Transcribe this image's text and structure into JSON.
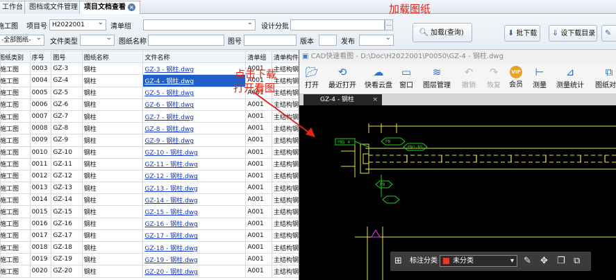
{
  "tabs": [
    {
      "label": "工作台"
    },
    {
      "label": "图档或文件管理"
    },
    {
      "label": "项目文档查看",
      "close": "×"
    }
  ],
  "annotations": {
    "load_drawing": "加载图纸",
    "click_download_line1": "点击下载",
    "click_download_line2": "打开看图"
  },
  "filters": {
    "drawing_label": "施工图",
    "project_no_label": "项目号",
    "project_no_value": "H2022001",
    "checklist_label": "清单组",
    "checklist_value": "",
    "design_batch_label": "设计分批",
    "design_batch_value": "",
    "category_value": "-全部图纸-",
    "file_type_label": "文件类型",
    "file_type_value": "",
    "drawing_name_label": "图纸名称",
    "drawing_name_value": "",
    "drawing_no_label": "图号",
    "drawing_no_value": "",
    "version_label": "版本",
    "version_value": "",
    "publish_label": "发布",
    "publish_value": "",
    "dots": "..."
  },
  "buttons": {
    "load": "加载(查询)",
    "batch_download": "批下载",
    "set_download_dir": "设下载目录"
  },
  "table": {
    "headers": [
      "图纸类别",
      "序号",
      "图号",
      "图纸名称",
      "文件名称",
      "清单组",
      "清单构件"
    ],
    "rows": [
      [
        "施工图",
        "0003",
        "GZ-3",
        "钢柱",
        "GZ-3 - 钢柱.dwg",
        "A001",
        "主结构钢"
      ],
      [
        "施工图",
        "0004",
        "GZ-4",
        "钢柱",
        "GZ-4 - 钢柱.dwg",
        "A001",
        "主结构钢"
      ],
      [
        "施工图",
        "0005",
        "GZ-5",
        "钢柱",
        "GZ-5 - 钢柱.dwg",
        "A001",
        "主结构钢"
      ],
      [
        "施工图",
        "0006",
        "GZ-6",
        "钢柱",
        "GZ-6 - 钢柱.dwg",
        "A001",
        "主结构钢"
      ],
      [
        "施工图",
        "0007",
        "GZ-7",
        "钢柱",
        "GZ-7 - 钢柱.dwg",
        "A001",
        "主结构钢"
      ],
      [
        "施工图",
        "0008",
        "GZ-8",
        "钢柱",
        "GZ-8 - 钢柱.dwg",
        "A001",
        "主结构钢"
      ],
      [
        "施工图",
        "0009",
        "GZ-9",
        "钢柱",
        "GZ-9 - 钢柱.dwg",
        "A001",
        "主结构钢"
      ],
      [
        "施工图",
        "0010",
        "GZ-10",
        "钢柱",
        "GZ-10 - 钢柱.dwg",
        "A001",
        "主结构钢"
      ],
      [
        "施工图",
        "0011",
        "GZ-11",
        "钢柱",
        "GZ-11 - 钢柱.dwg",
        "A001",
        "主结构钢"
      ],
      [
        "施工图",
        "0012",
        "GZ-12",
        "钢柱",
        "GZ-12 - 钢柱.dwg",
        "A001",
        "主结构钢"
      ],
      [
        "施工图",
        "0013",
        "GZ-13",
        "钢柱",
        "GZ-13 - 钢柱.dwg",
        "A001",
        "主结构钢"
      ],
      [
        "施工图",
        "0014",
        "GZ-14",
        "钢柱",
        "GZ-14 - 钢柱.dwg",
        "A001",
        "主结构钢"
      ],
      [
        "施工图",
        "0015",
        "GZ-15",
        "钢柱",
        "GZ-15 - 钢柱.dwg",
        "A001",
        "主结构钢"
      ],
      [
        "施工图",
        "0016",
        "GZ-16",
        "钢柱",
        "GZ-16 - 钢柱.dwg",
        "A001",
        "主结构钢"
      ],
      [
        "施工图",
        "0017",
        "GZ-17",
        "钢柱",
        "GZ-17 - 钢柱.dwg",
        "A001",
        "主结构钢"
      ],
      [
        "施工图",
        "0018",
        "GZ-18",
        "钢柱",
        "GZ-18 - 钢柱.dwg",
        "A001",
        "主结构钢"
      ],
      [
        "施工图",
        "0019",
        "GZ-19",
        "钢柱",
        "GZ-19 - 钢柱.dwg",
        "A001",
        "主结构钢"
      ],
      [
        "施工图",
        "0020",
        "GZ-20",
        "钢柱",
        "GZ-20 - 钢柱.dwg",
        "A001",
        "主结构钢"
      ]
    ],
    "selected_index": 1
  },
  "cad": {
    "title": "CAD快速看图 - D:\\Doc\\H2022001\\P0050\\GZ-4 - 钢柱.dwg",
    "ribbon": [
      {
        "label": "打开",
        "icon": "folder-icon",
        "disabled": false
      },
      {
        "label": "最近打开",
        "icon": "clock-icon",
        "disabled": false
      },
      {
        "label": "快看云盘",
        "icon": "cloud-icon",
        "disabled": false
      },
      {
        "label": "窗口",
        "icon": "window-icon",
        "disabled": false
      },
      {
        "label": "图层管理",
        "icon": "layers-icon",
        "disabled": false
      },
      {
        "label": "撤销",
        "icon": "undo-icon",
        "disabled": true
      },
      {
        "label": "恢复",
        "icon": "redo-icon",
        "disabled": true
      },
      {
        "label": "会员",
        "icon": "vip-icon",
        "disabled": false
      },
      {
        "label": "测量",
        "icon": "measure-icon",
        "disabled": false
      },
      {
        "label": "测量统计",
        "icon": "measure-stats-icon",
        "disabled": false
      },
      {
        "label": "图纸对比",
        "icon": "compare-icon",
        "disabled": false
      }
    ],
    "vip_badge": "VIP",
    "doc_tab": "GZ-4 - 钢柱",
    "doc_tab_close": "×",
    "annotations": {
      "pn1": "PN1 4",
      "pn": "PN",
      "pn5": "PN1 B5",
      "pn6": "PN"
    },
    "colors": {
      "canvas": "#000000",
      "green": "#19d219",
      "yellow": "#e8e840",
      "magenta": "#e040e0",
      "red": "#e23a2a"
    }
  },
  "float_toolbar": {
    "label": "标注分类",
    "category": "未分类"
  }
}
